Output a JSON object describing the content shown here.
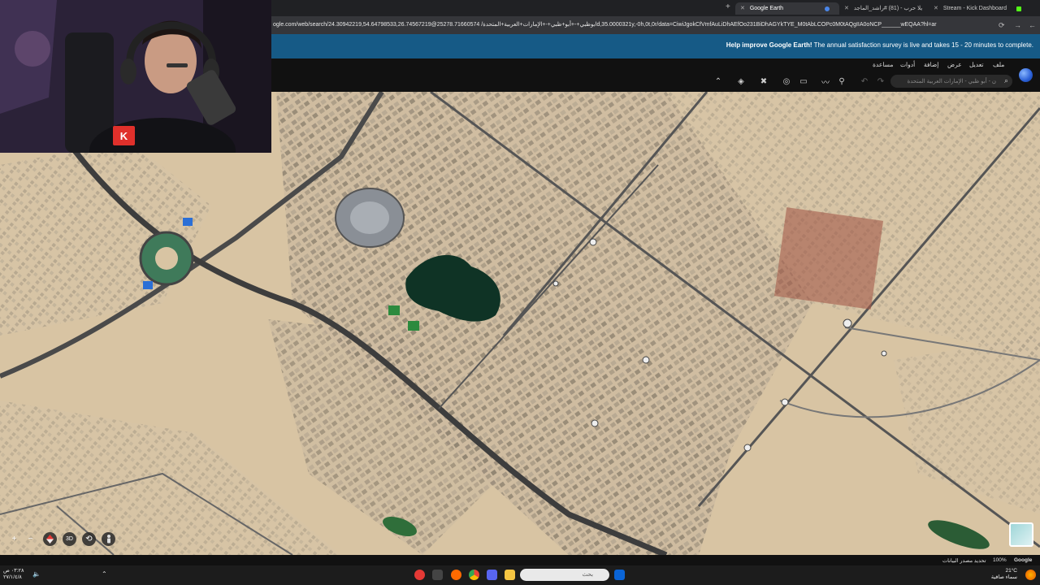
{
  "browser": {
    "tabs": [
      {
        "title": "Google Earth",
        "active": true,
        "favicon_color": "#4a86e8"
      },
      {
        "title": "يلا حرب - (81) #راشد_الماجد",
        "active": false,
        "favicon_color": "#e53935"
      },
      {
        "title": "Stream - Kick Dashboard",
        "active": false,
        "favicon_color": "#53fc18"
      }
    ],
    "url": "ogle.com/web/search/24.30942219,54.64798533,26.74567219@ابوظبي+-+أبو+ظبي+-+الإمارات+العربية+المتحدة/ 25278.71660574d,35.0000321y,-0h,0t,0r/data=CiwiJgokCfVmfAuLiDhAEfOo231BiDhAGYkTYE_M0tAbLCOPc0M0tAQgIIA0oNCP______wEQAA?hl=ar"
  },
  "banner": {
    "bold": "Help improve Google Earth!",
    "text": " The annual satisfaction survey is live and takes 15 - 20 minutes to complete."
  },
  "menu": [
    "ملف",
    "تعديل",
    "عرض",
    "إضافة",
    "أدوات",
    "مساعدة"
  ],
  "search": {
    "placeholder": "ن - أبو ظبي - الإمارات العربية المتحدة"
  },
  "status": {
    "google": "Google",
    "zoom": "100%",
    "update": "تحديد مصدر البيانات"
  },
  "taskbar": {
    "search_label": "بحث",
    "time": "٠٣:٢٨ ص",
    "date": "٢٧/١/٤/٨",
    "weather_temp": "21°C",
    "weather_desc": "سماء صافية"
  },
  "webcam": {
    "badge": "K"
  }
}
